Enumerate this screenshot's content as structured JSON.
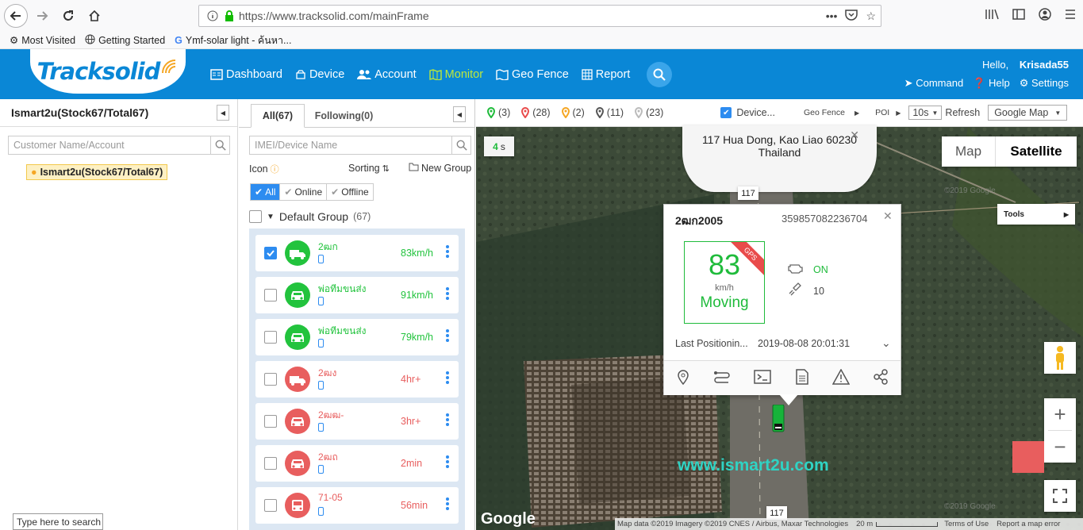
{
  "browser": {
    "url": "https://www.tracksolid.com/mainFrame",
    "bookmarks": [
      "Most Visited",
      "Getting Started",
      "Ymf-solar light - ค้นหา..."
    ]
  },
  "header": {
    "logo": "Tracksolid",
    "nav": [
      "Dashboard",
      "Device",
      "Account",
      "Monitor",
      "Geo Fence",
      "Report"
    ],
    "active": "Monitor",
    "greeting": "Hello,",
    "username": "Krisada55",
    "links": [
      "Command",
      "Help",
      "Settings"
    ]
  },
  "left": {
    "title": "Ismart2u(Stock67/Total67)",
    "search_placeholder": "Customer Name/Account",
    "tree_root": "Ismart2u(Stock67/Total67)"
  },
  "middle": {
    "tabs": [
      "All(67)",
      "Following(0)"
    ],
    "search_placeholder": "IMEI/Device Name",
    "icon_label": "Icon",
    "sorting_label": "Sorting",
    "new_group": "New Group",
    "filters": [
      "All",
      "Online",
      "Offline"
    ],
    "group_name": "Default Group",
    "group_count": "(67)",
    "vehicles": [
      {
        "name": "2ฒก",
        "speed": "83km/h",
        "status": "moving",
        "checked": true,
        "type": "truck"
      },
      {
        "name": "พ่อทีมขนส่ง",
        "speed": "91km/h",
        "status": "moving",
        "checked": false,
        "type": "car"
      },
      {
        "name": "พ่อทีมขนส่ง",
        "speed": "79km/h",
        "status": "moving",
        "checked": false,
        "type": "car"
      },
      {
        "name": "2ฒง",
        "speed": "4hr+",
        "status": "offline",
        "checked": false,
        "type": "truck"
      },
      {
        "name": "2ฒฒ-",
        "speed": "3hr+",
        "status": "offline",
        "checked": false,
        "type": "car"
      },
      {
        "name": "2ฒถ",
        "speed": "2min",
        "status": "offline",
        "checked": false,
        "type": "car"
      },
      {
        "name": "71-05",
        "speed": "56min",
        "status": "offline",
        "checked": false,
        "type": "bus"
      }
    ]
  },
  "map": {
    "stats": [
      {
        "count": "(3)",
        "color": "#1fbb3b"
      },
      {
        "count": "(28)",
        "color": "#e94b4b"
      },
      {
        "count": "(2)",
        "color": "#f5a623"
      },
      {
        "count": "(11)",
        "color": "#555555"
      },
      {
        "count": "(23)",
        "color": "#bbbbbb"
      }
    ],
    "device_label": "Device...",
    "geofence_label": "Geo Fence",
    "poi_label": "POI",
    "interval": "10s",
    "refresh": "Refresh",
    "maptype": "Google Map",
    "timer": "4",
    "timer_unit": "s",
    "map_btn": "Map",
    "satellite_btn": "Satellite",
    "tools": "Tools",
    "address_line1": "117 Hua Dong, Kao Liao 60230",
    "address_line2": "Thailand",
    "road_label": "117",
    "watermark": "www.ismart2u.com",
    "google": "Google",
    "attribution": "Map data ©2019 Imagery ©2019 CNES / Airbus, Maxar Technologies",
    "scale": "20 m",
    "terms": "Terms of Use",
    "report": "Report a map error",
    "copyright_faint": "©2019 Google"
  },
  "popup": {
    "name": "2ฒก2005",
    "imei": "359857082236704",
    "speed": "83",
    "unit": "km/h",
    "state": "Moving",
    "gps": "GPS",
    "acc": "ON",
    "satellites": "10",
    "last_label": "Last Positionin...",
    "last_time": "2019-08-08 20:01:31"
  },
  "taskbar": {
    "search": "Type here to search"
  }
}
